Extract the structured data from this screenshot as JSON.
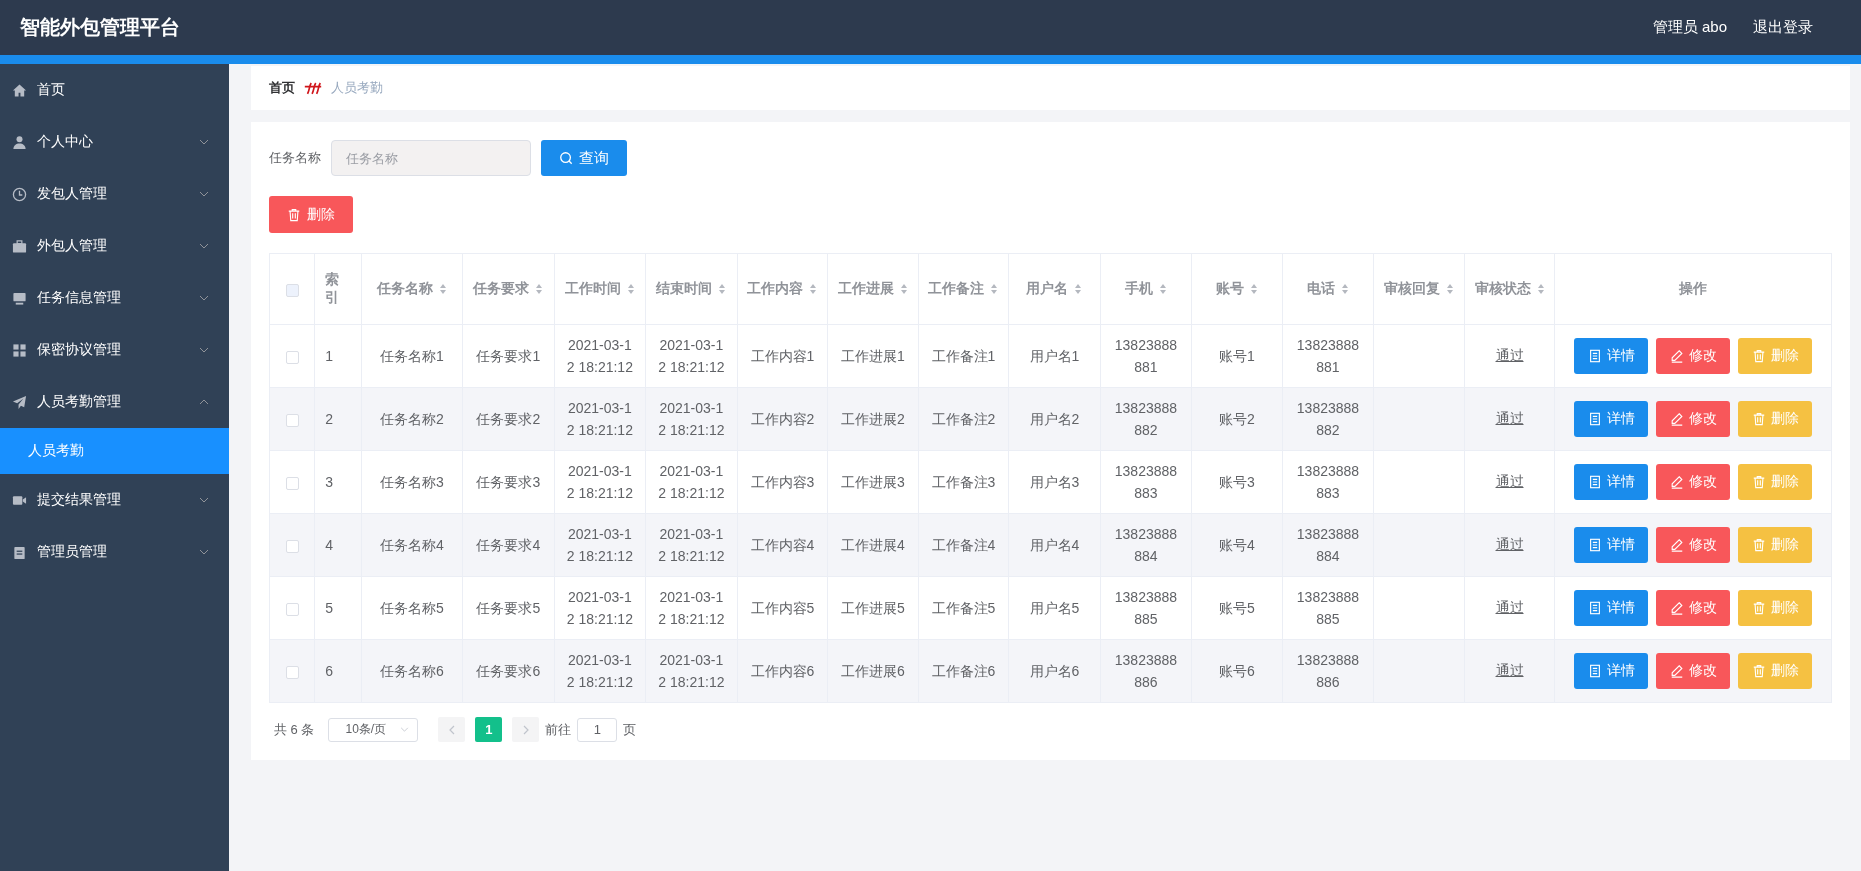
{
  "header": {
    "title": "智能外包管理平台",
    "user": "管理员 abo",
    "logout": "退出登录"
  },
  "sidebar": {
    "items": [
      {
        "kind": "link",
        "label": "首页",
        "selected": false
      },
      {
        "kind": "submenu",
        "label": "个人中心",
        "selected": false,
        "expanded": false
      },
      {
        "kind": "submenu",
        "label": "发包人管理",
        "selected": false,
        "expanded": false
      },
      {
        "kind": "submenu",
        "label": "外包人管理",
        "selected": false,
        "expanded": false
      },
      {
        "kind": "submenu",
        "label": "任务信息管理",
        "selected": false,
        "expanded": false
      },
      {
        "kind": "submenu",
        "label": "保密协议管理",
        "selected": false,
        "expanded": false
      },
      {
        "kind": "submenu",
        "label": "人员考勤管理",
        "selected": false,
        "expanded": true,
        "children": [
          {
            "label": "人员考勤",
            "selected": true
          }
        ]
      },
      {
        "kind": "submenu",
        "label": "提交结果管理",
        "selected": false,
        "expanded": false
      },
      {
        "kind": "submenu",
        "label": "管理员管理",
        "selected": false,
        "expanded": false
      }
    ]
  },
  "breadcrumb": {
    "home": "首页",
    "current": "人员考勤"
  },
  "search": {
    "label": "任务名称",
    "placeholder": "任务名称",
    "button": "查询"
  },
  "delete_button": "删除",
  "table": {
    "select_all": {
      "checked": false
    },
    "columns": [
      {
        "kind": "index",
        "label": "索引",
        "sortable": false
      },
      {
        "kind": "text",
        "label": "任务名称",
        "sortable": true
      },
      {
        "kind": "text",
        "label": "任务要求",
        "sortable": true
      },
      {
        "kind": "text",
        "label": "工作时间",
        "sortable": true
      },
      {
        "kind": "text",
        "label": "结束时间",
        "sortable": true
      },
      {
        "kind": "text",
        "label": "工作内容",
        "sortable": true
      },
      {
        "kind": "text",
        "label": "工作进展",
        "sortable": true
      },
      {
        "kind": "text",
        "label": "工作备注",
        "sortable": true
      },
      {
        "kind": "text",
        "label": "用户名",
        "sortable": true
      },
      {
        "kind": "text",
        "label": "手机",
        "sortable": true
      },
      {
        "kind": "text",
        "label": "账号",
        "sortable": true
      },
      {
        "kind": "text",
        "label": "电话",
        "sortable": true
      },
      {
        "kind": "text",
        "label": "审核回复",
        "sortable": true
      },
      {
        "kind": "status",
        "label": "审核状态",
        "sortable": true
      },
      {
        "kind": "actions",
        "label": "操作",
        "sortable": false
      }
    ],
    "rows": [
      {
        "checked": false,
        "cells": [
          "1",
          "任务名称1",
          "任务要求1",
          "2021-03-12 18:21:12",
          "2021-03-12 18:21:12",
          "工作内容1",
          "工作进展1",
          "工作备注1",
          "用户名1",
          "13823888881",
          "账号1",
          "13823888881"
        ],
        "status": "通过",
        "actions": [
          {
            "kind": "detail",
            "label": "详情"
          },
          {
            "kind": "edit",
            "label": "修改"
          },
          {
            "kind": "delete",
            "label": "删除"
          }
        ]
      },
      {
        "checked": false,
        "cells": [
          "2",
          "任务名称2",
          "任务要求2",
          "2021-03-12 18:21:12",
          "2021-03-12 18:21:12",
          "工作内容2",
          "工作进展2",
          "工作备注2",
          "用户名2",
          "13823888882",
          "账号2",
          "13823888882"
        ],
        "status": "通过",
        "actions": [
          {
            "kind": "detail",
            "label": "详情"
          },
          {
            "kind": "edit",
            "label": "修改"
          },
          {
            "kind": "delete",
            "label": "删除"
          }
        ]
      },
      {
        "checked": false,
        "cells": [
          "3",
          "任务名称3",
          "任务要求3",
          "2021-03-12 18:21:12",
          "2021-03-12 18:21:12",
          "工作内容3",
          "工作进展3",
          "工作备注3",
          "用户名3",
          "13823888883",
          "账号3",
          "13823888883"
        ],
        "status": "通过",
        "actions": [
          {
            "kind": "detail",
            "label": "详情"
          },
          {
            "kind": "edit",
            "label": "修改"
          },
          {
            "kind": "delete",
            "label": "删除"
          }
        ]
      },
      {
        "checked": false,
        "cells": [
          "4",
          "任务名称4",
          "任务要求4",
          "2021-03-12 18:21:12",
          "2021-03-12 18:21:12",
          "工作内容4",
          "工作进展4",
          "工作备注4",
          "用户名4",
          "13823888884",
          "账号4",
          "13823888884"
        ],
        "status": "通过",
        "actions": [
          {
            "kind": "detail",
            "label": "详情"
          },
          {
            "kind": "edit",
            "label": "修改"
          },
          {
            "kind": "delete",
            "label": "删除"
          }
        ]
      },
      {
        "checked": false,
        "cells": [
          "5",
          "任务名称5",
          "任务要求5",
          "2021-03-12 18:21:12",
          "2021-03-12 18:21:12",
          "工作内容5",
          "工作进展5",
          "工作备注5",
          "用户名5",
          "13823888885",
          "账号5",
          "13823888885"
        ],
        "status": "通过",
        "actions": [
          {
            "kind": "detail",
            "label": "详情"
          },
          {
            "kind": "edit",
            "label": "修改"
          },
          {
            "kind": "delete",
            "label": "删除"
          }
        ]
      },
      {
        "checked": false,
        "cells": [
          "6",
          "任务名称6",
          "任务要求6",
          "2021-03-12 18:21:12",
          "2021-03-12 18:21:12",
          "工作内容6",
          "工作进展6",
          "工作备注6",
          "用户名6",
          "13823888886",
          "账号6",
          "13823888886"
        ],
        "status": "通过",
        "actions": [
          {
            "kind": "detail",
            "label": "详情"
          },
          {
            "kind": "edit",
            "label": "修改"
          },
          {
            "kind": "delete",
            "label": "删除"
          }
        ]
      }
    ]
  },
  "pagination": {
    "total": "共 6 条",
    "page_size": "10条/页",
    "pages": [
      {
        "label": "1",
        "selected": true
      }
    ],
    "goto_label": "前往",
    "goto_value": "1",
    "goto_suffix": "页"
  }
}
